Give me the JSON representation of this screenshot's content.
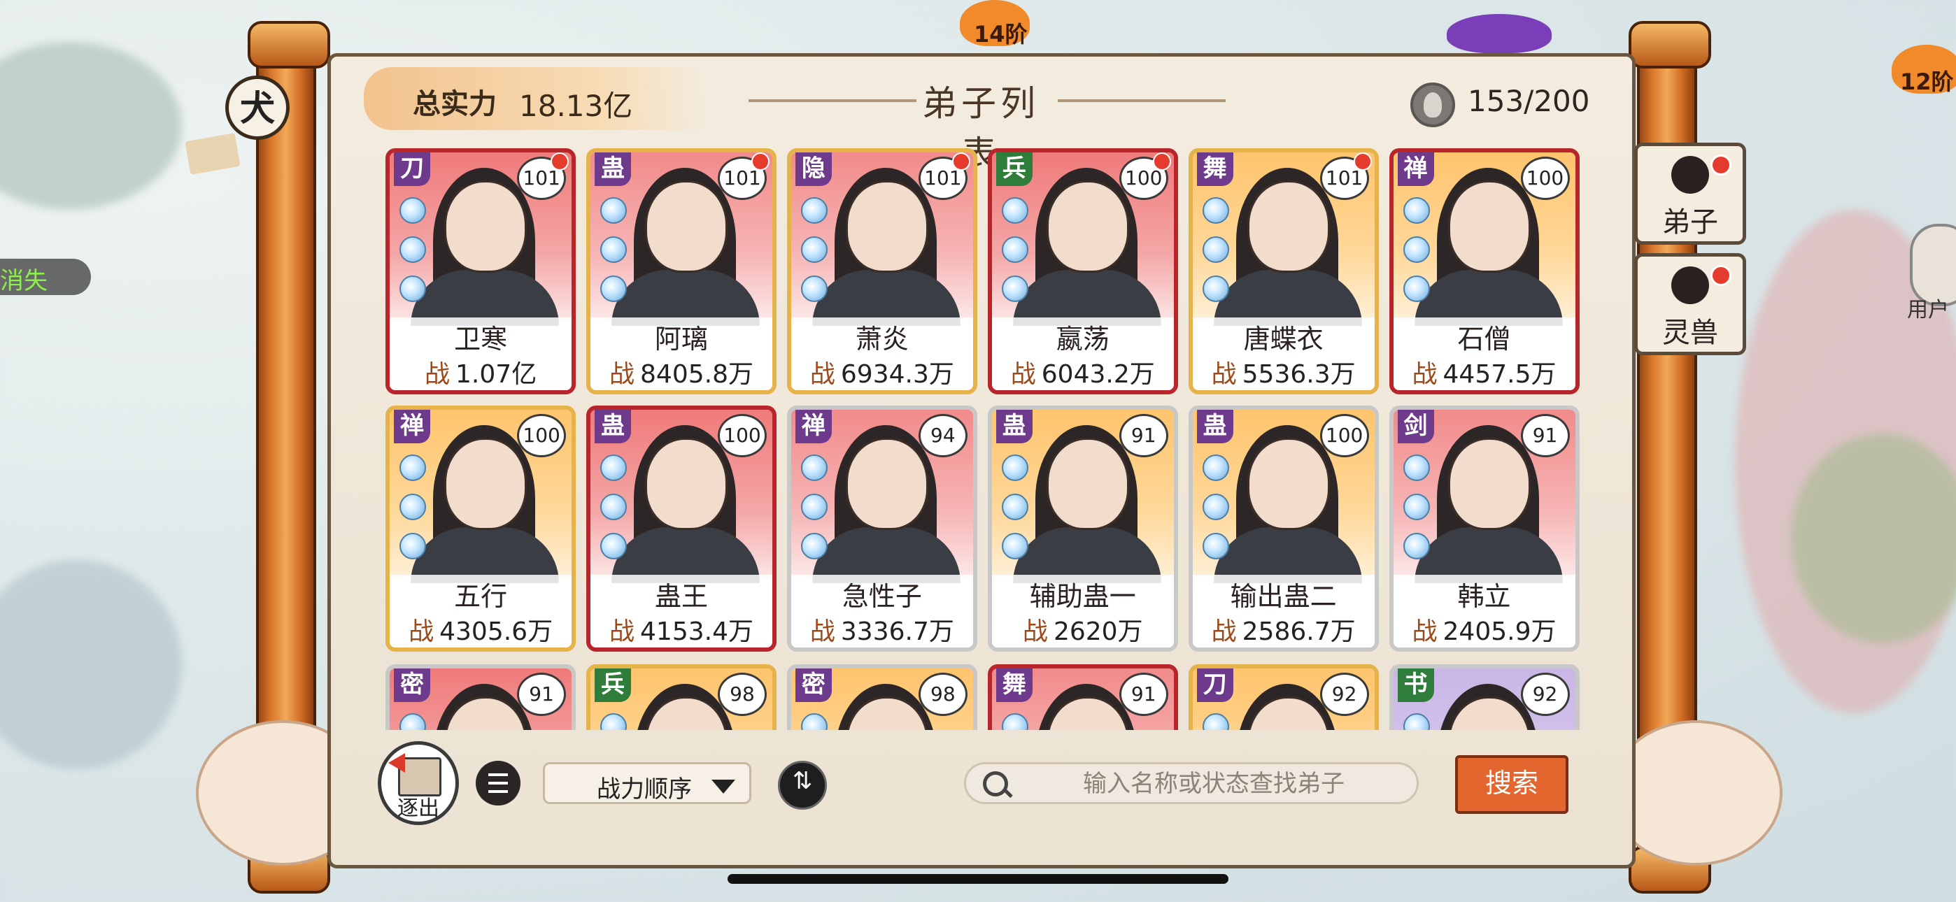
{
  "header": {
    "total_power_label": "总实力",
    "total_power_value": "18.13亿",
    "title": "弟子列表",
    "count": "153/200"
  },
  "disciples": [
    {
      "name": "卫寒",
      "tag": "刀",
      "level": "101",
      "power": "1.07亿",
      "frame": "red",
      "bg": "red",
      "dot": true
    },
    {
      "name": "阿璃",
      "tag": "蛊",
      "level": "101",
      "power": "8405.8万",
      "frame": "gold",
      "bg": "pink",
      "dot": true
    },
    {
      "name": "萧炎",
      "tag": "隐",
      "level": "101",
      "power": "6934.3万",
      "frame": "gold",
      "bg": "pink",
      "dot": true
    },
    {
      "name": "嬴荡",
      "tag": "兵",
      "level": "100",
      "power": "6043.2万",
      "frame": "red",
      "bg": "red",
      "dot": true,
      "tag_color": "green"
    },
    {
      "name": "唐蝶衣",
      "tag": "舞",
      "level": "101",
      "power": "5536.3万",
      "frame": "gold",
      "bg": "gold",
      "dot": true
    },
    {
      "name": "石僧",
      "tag": "禅",
      "level": "100",
      "power": "4457.5万",
      "frame": "gold",
      "bg": "red",
      "dot": false
    },
    {
      "name": "五行",
      "tag": "禅",
      "level": "100",
      "power": "4305.6万",
      "frame": "gold",
      "bg": "gold",
      "dot": false
    },
    {
      "name": "蛊王",
      "tag": "蛊",
      "level": "100",
      "power": "4153.4万",
      "frame": "red",
      "bg": "red",
      "dot": false
    },
    {
      "name": "急性子",
      "tag": "禅",
      "level": "94",
      "power": "3336.7万",
      "frame": "silver",
      "bg": "pink",
      "dot": false
    },
    {
      "name": "辅助蛊一",
      "tag": "蛊",
      "level": "91",
      "power": "2620万",
      "frame": "silver",
      "bg": "gold",
      "dot": false
    },
    {
      "name": "输出蛊二",
      "tag": "蛊",
      "level": "100",
      "power": "2586.7万",
      "frame": "silver",
      "bg": "gold",
      "dot": false
    },
    {
      "name": "韩立",
      "tag": "剑",
      "level": "91",
      "power": "2405.9万",
      "frame": "silver",
      "bg": "pink",
      "dot": false
    },
    {
      "name": "",
      "tag": "密",
      "level": "91",
      "power": "",
      "frame": "silver",
      "bg": "red",
      "dot": false
    },
    {
      "name": "",
      "tag": "兵",
      "level": "98",
      "power": "",
      "frame": "gold",
      "bg": "gold",
      "dot": false,
      "tag_color": "green"
    },
    {
      "name": "",
      "tag": "密",
      "level": "98",
      "power": "",
      "frame": "silver",
      "bg": "gold",
      "dot": false
    },
    {
      "name": "",
      "tag": "舞",
      "level": "91",
      "power": "",
      "frame": "red",
      "bg": "pink",
      "dot": false
    },
    {
      "name": "",
      "tag": "刀",
      "level": "92",
      "power": "",
      "frame": "gold",
      "bg": "gold",
      "dot": false
    },
    {
      "name": "",
      "tag": "书",
      "level": "92",
      "power": "",
      "frame": "silver",
      "bg": "lavender",
      "dot": false,
      "tag_color": "green"
    }
  ],
  "power_prefix": "战",
  "side_tabs": [
    {
      "label": "弟子",
      "icon": "disciple-icon",
      "dot": true
    },
    {
      "label": "灵兽",
      "icon": "spirit-beast-icon",
      "dot": true
    }
  ],
  "controls": {
    "expel_label": "逐出",
    "sort_label": "战力顺序",
    "search_placeholder": "输入名称或状态查找弟子",
    "search_button": "搜索",
    "swap_glyph": "⇅"
  },
  "peripheral": {
    "left_badge": "消失",
    "knot_glyph": "犬",
    "flame_1": "14阶",
    "flame_2": "12阶",
    "user_label": "用户"
  },
  "colors": {
    "frame_red": "#b8252a",
    "frame_gold": "#e6b24a",
    "frame_silver": "#c8c8c8",
    "accent_orange": "#e2662d",
    "red_dot": "#e53b2c"
  }
}
